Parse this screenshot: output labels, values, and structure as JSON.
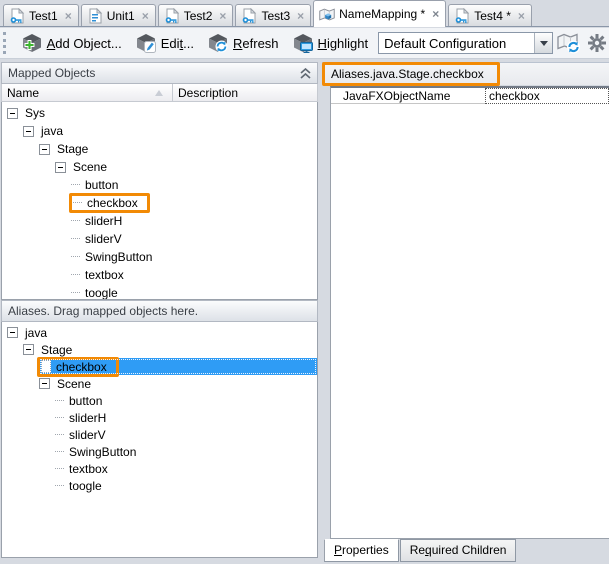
{
  "tabs": [
    {
      "label": "Test1",
      "icon": "keyword-test-icon",
      "active": false
    },
    {
      "label": "Unit1",
      "icon": "script-icon",
      "active": false
    },
    {
      "label": "Test2",
      "icon": "keyword-test-icon",
      "active": false
    },
    {
      "label": "Test3",
      "icon": "keyword-test-icon",
      "active": false
    },
    {
      "label": "NameMapping *",
      "icon": "namemapping-icon",
      "active": true
    },
    {
      "label": "Test4 *",
      "icon": "keyword-test-icon",
      "active": false
    }
  ],
  "toolbar": {
    "buttons": [
      {
        "label": "Add Object...",
        "accel": 0,
        "icon": "add-object-icon"
      },
      {
        "label": "Edit...",
        "accel": 3,
        "icon": "edit-object-icon"
      },
      {
        "label": "Refresh",
        "accel": 0,
        "icon": "refresh-object-icon"
      },
      {
        "label": "Highlight",
        "accel": 0,
        "icon": "highlight-object-icon"
      }
    ],
    "configuration_select": {
      "value": "Default Configuration"
    },
    "right_icons": [
      {
        "name": "update-namemapping-icon"
      },
      {
        "name": "settings-gear-icon"
      }
    ]
  },
  "mapped_objects": {
    "title": "Mapped Objects",
    "columns": [
      "Name",
      "Description"
    ],
    "tree": [
      {
        "label": "Sys",
        "depth": 0,
        "node": true
      },
      {
        "label": "java",
        "depth": 1,
        "node": true
      },
      {
        "label": "Stage",
        "depth": 2,
        "node": true
      },
      {
        "label": "Scene",
        "depth": 3,
        "node": true
      },
      {
        "label": "button",
        "depth": 4
      },
      {
        "label": "checkbox",
        "depth": 4,
        "annotated": true
      },
      {
        "label": "sliderH",
        "depth": 4
      },
      {
        "label": "sliderV",
        "depth": 4
      },
      {
        "label": "SwingButton",
        "depth": 4
      },
      {
        "label": "textbox",
        "depth": 4
      },
      {
        "label": "toogle",
        "depth": 4
      }
    ]
  },
  "aliases": {
    "title": "Aliases. Drag mapped objects here.",
    "tree": [
      {
        "label": "java",
        "depth": 0,
        "node": true
      },
      {
        "label": "Stage",
        "depth": 1,
        "node": true
      },
      {
        "label": "checkbox",
        "depth": 2,
        "selected": true,
        "annotated": true
      },
      {
        "label": "Scene",
        "depth": 2,
        "node": true
      },
      {
        "label": "button",
        "depth": 3
      },
      {
        "label": "sliderH",
        "depth": 3
      },
      {
        "label": "sliderV",
        "depth": 3
      },
      {
        "label": "SwingButton",
        "depth": 3
      },
      {
        "label": "textbox",
        "depth": 3
      },
      {
        "label": "toogle",
        "depth": 3
      }
    ]
  },
  "inspector": {
    "path": "Aliases.java.Stage.checkbox",
    "properties": [
      {
        "name": "JavaFXObjectName",
        "value": "checkbox"
      }
    ],
    "tabs": [
      {
        "label": "Properties",
        "accel": 0,
        "active": true
      },
      {
        "label": "Required Children",
        "accel": 2,
        "active": false
      }
    ]
  },
  "colors": {
    "annotation_orange": "#f28a05",
    "selection_blue": "#2f9cf5"
  }
}
